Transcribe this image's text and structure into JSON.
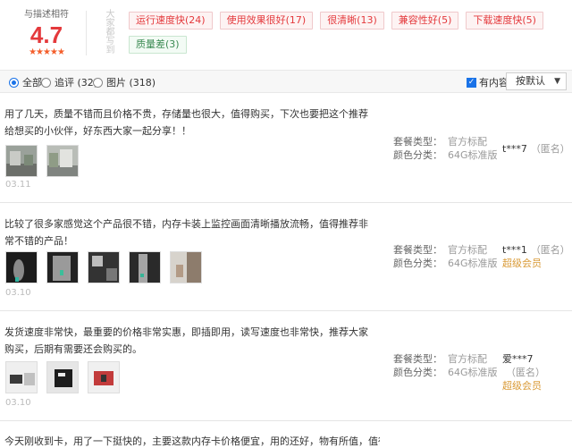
{
  "summary": {
    "title": "与描述相符",
    "score": "4.7",
    "stars": "★★★★★",
    "vertical_label": "大家都写到",
    "tags": [
      {
        "label": "运行速度快(24)",
        "kind": "pos"
      },
      {
        "label": "使用效果很好(17)",
        "kind": "pos"
      },
      {
        "label": "很清晰(13)",
        "kind": "pos"
      },
      {
        "label": "兼容性好(5)",
        "kind": "pos"
      },
      {
        "label": "下载速度快(5)",
        "kind": "pos"
      },
      {
        "label": "质量差(3)",
        "kind": "neg"
      }
    ]
  },
  "filters": {
    "all": "全部",
    "followup": "追评 (32)",
    "pictures": "图片 (318)",
    "has_content": "有内容",
    "sort": "按默认",
    "sort_arrow": "▼",
    "check_mark": "✓"
  },
  "reviews": [
    {
      "text": "用了几天，质量不错而且价格不贵，存储量也很大，值得购买，下次也要把这个推荐给想买的小伙伴，好东西大家一起分享！！",
      "date": "03.11",
      "package_label": "套餐类型：",
      "package_value": "官方标配",
      "color_label": "颜色分类：",
      "color_value": "64G标准版",
      "user": "t***7",
      "anon": "（匿名）",
      "level": ""
    },
    {
      "text": "比较了很多家感觉这个产品很不错，内存卡装上监控画面清晰播放流畅，值得推荐非常不错的产品！",
      "date": "03.10",
      "package_label": "套餐类型：",
      "package_value": "官方标配",
      "color_label": "颜色分类：",
      "color_value": "64G标准版",
      "user": "t***1",
      "anon": "（匿名）",
      "level": "超级会员"
    },
    {
      "text": "发货速度非常快，最重要的价格非常实惠，即插即用，读写速度也非常快，推荐大家购买，后期有需要还会购买的。",
      "date": "03.10",
      "package_label": "套餐类型：",
      "package_value": "官方标配",
      "color_label": "颜色分类：",
      "color_value": "64G标准版",
      "user": "爱***7",
      "anon": "（匿名）",
      "level": "超级会员"
    },
    {
      "text": "今天刚收到卡，用了一下挺快的，主要这款内存卡价格便宜，用的还好，物有所值，值得拥",
      "date": "",
      "package_label": "",
      "package_value": "",
      "color_label": "",
      "color_value": "",
      "user": "",
      "anon": "",
      "level": ""
    }
  ]
}
